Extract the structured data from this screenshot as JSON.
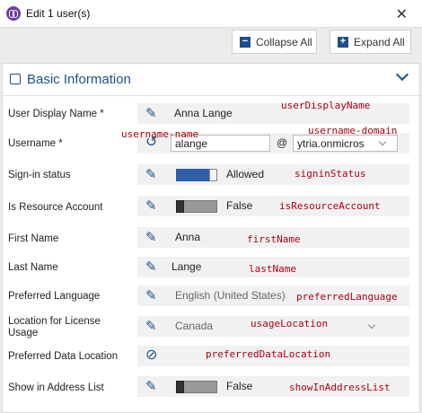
{
  "window": {
    "title": "Edit 1 user(s)",
    "close_glyph": "✕",
    "app_icon": "app-logo-icon"
  },
  "toolbar": {
    "collapse_label": "Collapse All",
    "expand_label": "Expand All",
    "collapse_glyph": "−",
    "expand_glyph": "+"
  },
  "section": {
    "title": "Basic Information"
  },
  "icons": {
    "edit": "✎",
    "undo": "↺",
    "blocked": "⊘"
  },
  "rows": {
    "display_name": {
      "label": "User Display Name *",
      "value": "Anna Lange",
      "annotation": "userDisplayName"
    },
    "username": {
      "label": "Username *",
      "value": "alange",
      "at": "@",
      "domain": "ytria.onmicros",
      "annotation_name": "username-name",
      "annotation_domain": "username-domain"
    },
    "signin": {
      "label": "Sign-in status",
      "value": "Allowed",
      "annotation": "signinStatus"
    },
    "resource": {
      "label": "Is Resource Account",
      "value": "False",
      "annotation": "isResourceAccount"
    },
    "first_name": {
      "label": "First Name",
      "value": "Anna",
      "annotation": "firstName"
    },
    "last_name": {
      "label": "Last Name",
      "value": "Lange",
      "annotation": "lastName"
    },
    "language": {
      "label": "Preferred Language",
      "value": "English (United States)",
      "annotation": "preferredLanguage"
    },
    "location": {
      "label": "Location for License Usage",
      "value": "Canada",
      "annotation": "usageLocation"
    },
    "data_location": {
      "label": "Preferred Data Location",
      "annotation": "preferredDataLocation"
    },
    "address_list": {
      "label": "Show in Address List",
      "value": "False",
      "annotation": "showInAddressList"
    }
  }
}
